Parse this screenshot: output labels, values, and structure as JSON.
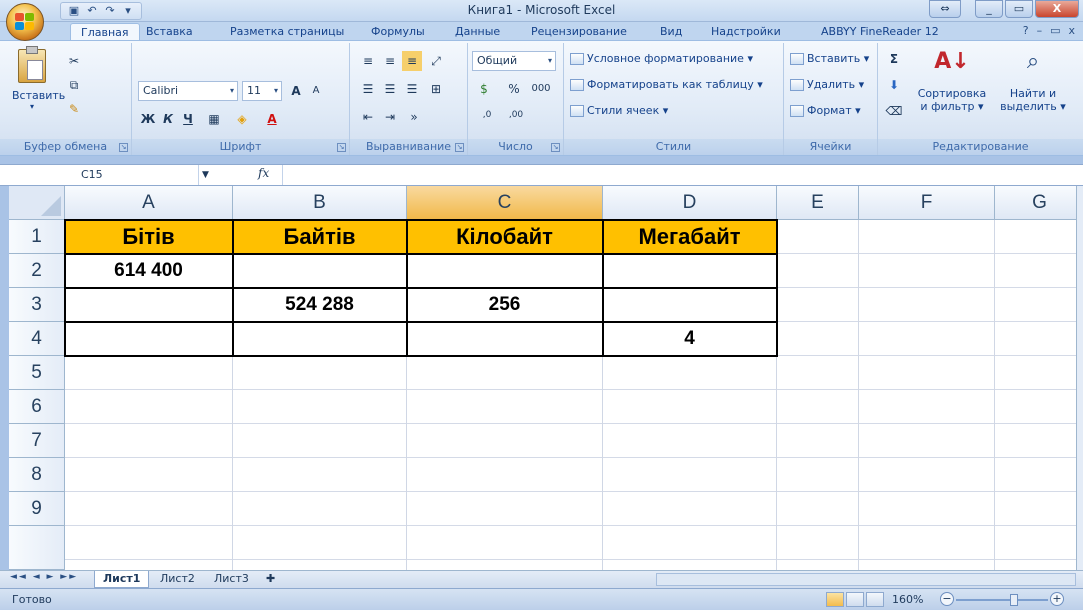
{
  "window": {
    "title": "Книга1 - Microsoft Excel",
    "controls": [
      "⇔",
      "_",
      "▭",
      "X"
    ]
  },
  "quick_access": {
    "save_icon": "save-icon",
    "undo_icon": "undo-icon",
    "redo_icon": "redo-icon"
  },
  "tabs": [
    "Главная",
    "Вставка",
    "Разметка страницы",
    "Формулы",
    "Данные",
    "Рецензирование",
    "Вид",
    "Надстройки",
    "ABBYY FineReader 12"
  ],
  "ribbon": {
    "clipboard": {
      "label": "Буфер обмена",
      "paste": "Вставить"
    },
    "font": {
      "label": "Шрифт",
      "name": "Calibri",
      "size": "11",
      "bold": "Ж",
      "italic": "К",
      "underline": "Ч",
      "grow": "A",
      "shrink": "A"
    },
    "alignment": {
      "label": "Выравнивание"
    },
    "number": {
      "label": "Число",
      "format": "Общий",
      "percent": "%",
      "thousands": "000",
      "inc_decimal": ",0",
      "dec_decimal": ",00"
    },
    "styles": {
      "label": "Стили",
      "conditional": "Условное форматирование",
      "as_table": "Форматировать как таблицу",
      "cell_styles": "Стили ячеек"
    },
    "cells": {
      "label": "Ячейки",
      "insert": "Вставить",
      "delete": "Удалить",
      "format": "Формат"
    },
    "editing": {
      "label": "Редактирование",
      "sigma": "Σ",
      "sort_line1": "Сортировка",
      "sort_line2": "и фильтр",
      "find_line1": "Найти и",
      "find_line2": "выделить"
    }
  },
  "formula_bar": {
    "name_box": "C15",
    "fx": "fx",
    "value": ""
  },
  "sheet": {
    "columns": [
      "A",
      "B",
      "C",
      "D",
      "E",
      "F",
      "G"
    ],
    "selected_column": "C",
    "rows": [
      "1",
      "2",
      "3",
      "4",
      "5",
      "6",
      "7",
      "8",
      "9"
    ],
    "cells": {
      "A1": "Бітів",
      "B1": "Байтів",
      "C1": "Кілобайт",
      "D1": "Мегабайт",
      "A2": "614 400",
      "B3": "524 288",
      "C3": "256",
      "D4": "4"
    },
    "header_fill": "#ffc000"
  },
  "sheet_tabs": [
    "Лист1",
    "Лист2",
    "Лист3"
  ],
  "status": {
    "text": "Готово",
    "zoom": "160%"
  }
}
